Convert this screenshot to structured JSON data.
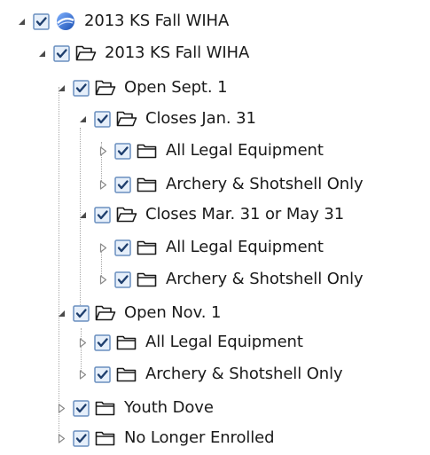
{
  "tree": {
    "nodes": [
      {
        "label": "2013 KS Fall WIHA",
        "expander": "expanded",
        "icon": "globe-icon",
        "checked": true
      },
      {
        "label": "2013 KS Fall WIHA",
        "expander": "expanded",
        "icon": "folder-open-icon",
        "checked": true
      },
      {
        "label": "Open Sept. 1",
        "expander": "expanded",
        "icon": "folder-open-icon",
        "checked": true
      },
      {
        "label": "Closes Jan. 31",
        "expander": "expanded",
        "icon": "folder-open-icon",
        "checked": true
      },
      {
        "label": "All Legal Equipment",
        "expander": "collapsed",
        "icon": "folder-icon",
        "checked": true
      },
      {
        "label": "Archery & Shotshell Only",
        "expander": "collapsed",
        "icon": "folder-icon",
        "checked": true
      },
      {
        "label": "Closes Mar. 31 or May 31",
        "expander": "expanded",
        "icon": "folder-open-icon",
        "checked": true
      },
      {
        "label": "All Legal Equipment",
        "expander": "collapsed",
        "icon": "folder-icon",
        "checked": true
      },
      {
        "label": "Archery & Shotshell Only",
        "expander": "collapsed",
        "icon": "folder-icon",
        "checked": true
      },
      {
        "label": "Open Nov. 1",
        "expander": "expanded",
        "icon": "folder-open-icon",
        "checked": true
      },
      {
        "label": "All Legal Equipment",
        "expander": "collapsed",
        "icon": "folder-icon",
        "checked": true
      },
      {
        "label": "Archery & Shotshell Only",
        "expander": "collapsed",
        "icon": "folder-icon",
        "checked": true
      },
      {
        "label": "Youth Dove",
        "expander": "collapsed",
        "icon": "folder-icon",
        "checked": true
      },
      {
        "label": "No Longer Enrolled",
        "expander": "collapsed",
        "icon": "folder-icon",
        "checked": true
      }
    ]
  },
  "colors": {
    "checkbox_border": "#6a8fbf",
    "checkbox_fill": "#e6effa",
    "checkmark": "#1f3f6e",
    "folder_stroke": "#1b1b1b",
    "globe_blue": "#2f64c8",
    "expander": "#4a4a4a"
  }
}
